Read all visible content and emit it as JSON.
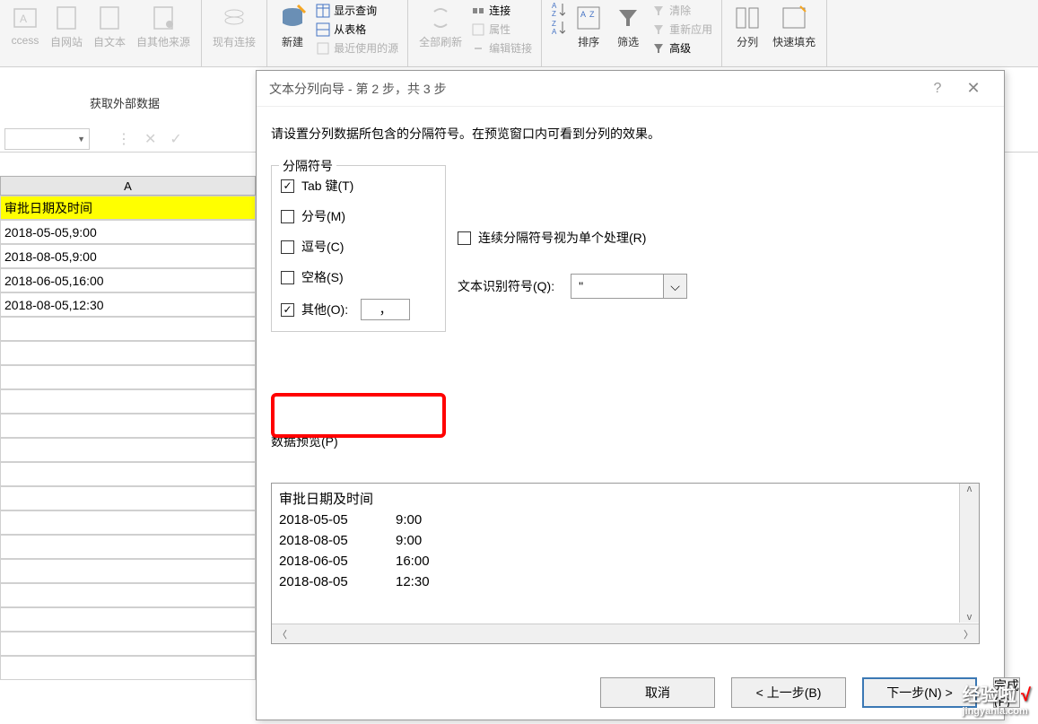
{
  "ribbon": {
    "access": "ccess",
    "fromweb": "自网站",
    "fromtext": "自文本",
    "othersources": "自其他来源",
    "existingconn": "现有连接",
    "newquery": "新建",
    "showquery": "显示查询",
    "fromtable": "从表格",
    "recentsources": "最近使用的源",
    "refreshall": "全部刷新",
    "connections": "连接",
    "properties": "属性",
    "editlinks": "编辑链接",
    "sortaz": "排序",
    "filter": "筛选",
    "clear": "清除",
    "reapply": "重新应用",
    "advanced": "高级",
    "texttocolumns": "分列",
    "flashfill": "快速填充"
  },
  "section": "获取外部数据",
  "sheet": {
    "colA": "A",
    "header": "审批日期及时间",
    "rows": [
      "2018-05-05,9:00",
      "2018-08-05,9:00",
      "2018-06-05,16:00",
      "2018-08-05,12:30"
    ]
  },
  "dialog": {
    "title": "文本分列向导 - 第 2 步，共 3 步",
    "desc": "请设置分列数据所包含的分隔符号。在预览窗口内可看到分列的效果。",
    "delim_label": "分隔符号",
    "tab": "Tab 键(T)",
    "semicolon": "分号(M)",
    "comma": "逗号(C)",
    "space": "空格(S)",
    "other": "其他(O):",
    "other_value": "，",
    "consecutive": "连续分隔符号视为单个处理(R)",
    "textqual_label": "文本识别符号(Q):",
    "textqual_value": "\"",
    "preview_label": "数据预览(P)",
    "preview": {
      "h1": "审批日期及时间",
      "rows": [
        {
          "c1": "2018-05-05",
          "c2": "9:00"
        },
        {
          "c1": "2018-08-05",
          "c2": "9:00"
        },
        {
          "c1": "2018-06-05",
          "c2": "16:00"
        },
        {
          "c1": "2018-08-05",
          "c2": "12:30"
        }
      ]
    },
    "btn_cancel": "取消",
    "btn_back": "< 上一步(B)",
    "btn_next": "下一步(N) >",
    "btn_finish": "完成(F)"
  },
  "watermark": {
    "main": "经验啦",
    "sub": "jingyanla.com"
  }
}
